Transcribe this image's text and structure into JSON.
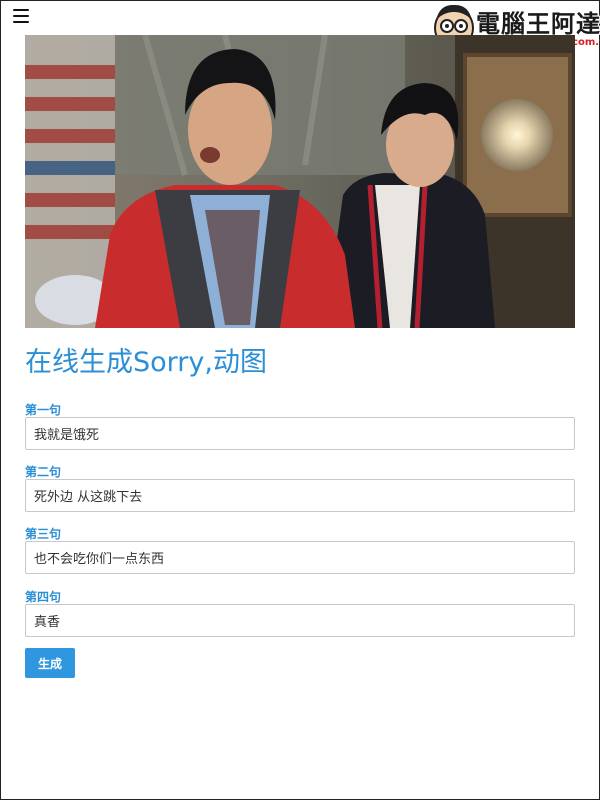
{
  "header": {
    "menu_icon": "hamburger-menu-icon"
  },
  "watermark": {
    "name": "電腦王阿達",
    "url": "http://www.kocpc.com.tw"
  },
  "hero": {
    "image_subject": "movie-still-two-young-men"
  },
  "page": {
    "title": "在线生成Sorry,动图"
  },
  "form": {
    "fields": [
      {
        "label": "第一句",
        "value": "我就是饿死"
      },
      {
        "label": "第二句",
        "value": "死外边 从这跳下去"
      },
      {
        "label": "第三句",
        "value": "也不会吃你们一点东西"
      },
      {
        "label": "第四句",
        "value": "真香"
      }
    ],
    "submit_label": "生成"
  },
  "colors": {
    "accent": "#2b8fd6",
    "button": "#2f96e0"
  }
}
